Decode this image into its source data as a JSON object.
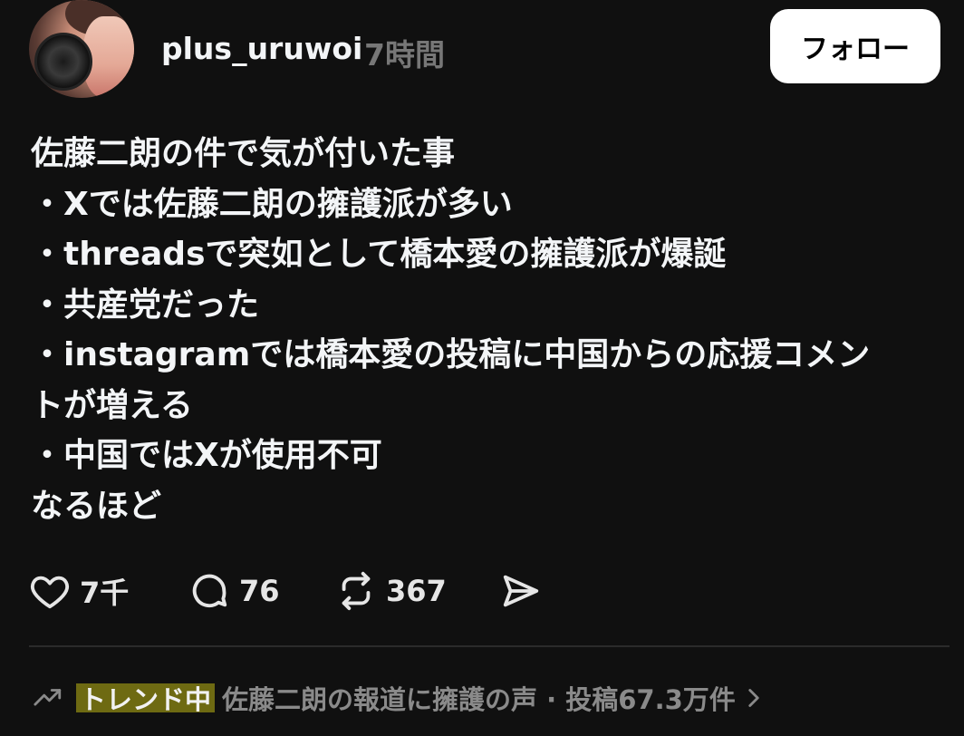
{
  "header": {
    "username": "plus_uruwoi",
    "timestamp": "7時間",
    "follow_label": "フォロー"
  },
  "post": {
    "lines": [
      "佐藤二朗の件で気が付いた事",
      "・Xでは佐藤二朗の擁護派が多い",
      "・threadsで突如として橋本愛の擁護派が爆誕",
      "・共産党だった",
      "・instagramでは橋本愛の投稿に中国からの応援コメン",
      "トが増える",
      "・中国ではXが使用不可",
      "なるほど"
    ]
  },
  "actions": {
    "likes": "7千",
    "comments": "76",
    "reposts": "367",
    "like_icon": "heart-icon",
    "comment_icon": "speech-bubble-icon",
    "repost_icon": "repost-icon",
    "share_icon": "send-icon"
  },
  "trend": {
    "badge": "トレンド中",
    "topic": "佐藤二朗の報道に擁護の声 · 投稿67.3万件",
    "icon": "trending-up-icon",
    "chevron_icon": "chevron-right-icon"
  },
  "colors": {
    "background": "#101010",
    "text": "#f3f5f7",
    "muted": "#777777",
    "highlight": "#6e6a12"
  }
}
